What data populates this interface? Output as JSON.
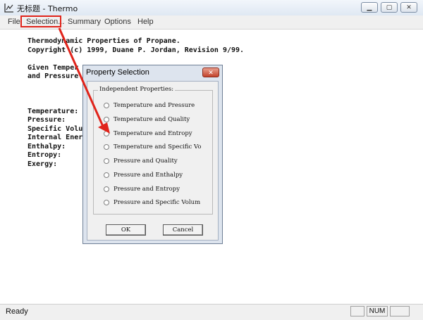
{
  "window": {
    "title": "无标题 - Thermo",
    "controls": [
      "minimize",
      "maximize",
      "close"
    ]
  },
  "menu": {
    "items": [
      "File",
      "Selection...",
      "Summary",
      "Options",
      "Help"
    ],
    "highlighted": "Selection..."
  },
  "document": {
    "heading": "Thermodynamic Properties of Propane.",
    "copyright": "Copyright (c) 1999, Duane P. Jordan, Revision 9/99.",
    "given_line1": "Given Temper",
    "given_line2": "and Pressure",
    "property_labels": [
      "Temperature:",
      "Pressure:",
      "Specific Volu",
      "Internal Ener",
      "Enthalpy:",
      "Entropy:",
      "Exergy:"
    ]
  },
  "dialog": {
    "title": "Property Selection",
    "group_label": "Independent Properties:",
    "options": [
      "Temperature and Pressure",
      "Temperature and Quality",
      "Temperature and Entropy",
      "Temperature and Specific Vo",
      "Pressure and Quality",
      "Pressure and Enthalpy",
      "Pressure and Entropy",
      "Pressure and Specific Volum"
    ],
    "ok_label": "OK",
    "cancel_label": "Cancel"
  },
  "status": {
    "text": "Ready",
    "indicator": "NUM"
  },
  "colors": {
    "annotation": "#e0241b",
    "close_button": "#c2422b"
  }
}
